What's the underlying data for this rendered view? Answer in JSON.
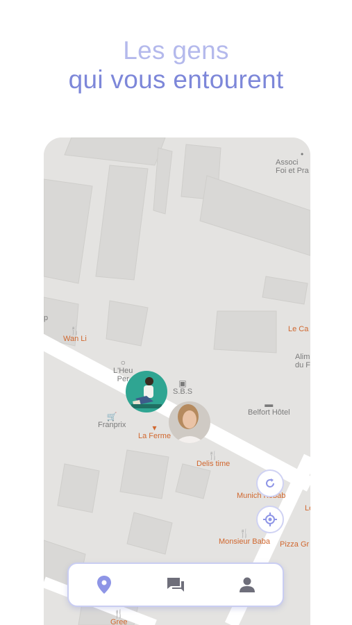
{
  "headline": {
    "line1": "Les gens",
    "line2": "qui vous entourent"
  },
  "map": {
    "pois": [
      {
        "id": "assoc",
        "label": "Associ",
        "label2": "Foi et Pra",
        "icon": "dot",
        "style": "gray"
      },
      {
        "id": "wanli",
        "label": "Wan Li",
        "icon": "restaurant-icon"
      },
      {
        "id": "lheu",
        "label": "L'Heu",
        "label2": "Per",
        "icon": "ring-icon",
        "style": "gray"
      },
      {
        "id": "sbs",
        "label": "S.B.S",
        "icon": "camera-icon",
        "style": "gray"
      },
      {
        "id": "lecaf",
        "label": "Le Ca",
        "icon": "none"
      },
      {
        "id": "alim",
        "label": "Alim",
        "label2": "du F",
        "icon": "none",
        "style": "gray"
      },
      {
        "id": "belfort",
        "label": "Belfort Hôtel",
        "icon": "bed-icon",
        "style": "gray"
      },
      {
        "id": "franprix",
        "label": "Franprix",
        "icon": "cart-icon",
        "style": "gray"
      },
      {
        "id": "laferme",
        "label": "La Ferme",
        "icon": "drink-icon"
      },
      {
        "id": "delis",
        "label": "Delis time",
        "icon": "restaurant-icon"
      },
      {
        "id": "munich",
        "label": "Munich Kebab",
        "icon": "none"
      },
      {
        "id": "baba",
        "label": "Monsieur Baba",
        "icon": "restaurant-icon"
      },
      {
        "id": "pizza",
        "label": "Pizza Gr",
        "icon": "none"
      },
      {
        "id": "le",
        "label": "Le",
        "icon": "none"
      },
      {
        "id": "gree",
        "label": "Gree",
        "icon": "restaurant-icon"
      },
      {
        "id": "p",
        "label": "p",
        "icon": "none",
        "style": "gray"
      }
    ],
    "users": [
      {
        "name": "avatar-man-teal"
      },
      {
        "name": "avatar-woman"
      }
    ]
  },
  "controls": {
    "refresh_icon": "refresh-icon",
    "locate_icon": "crosshair-icon"
  },
  "nav": {
    "items": [
      {
        "icon": "location-pin-icon",
        "active": true
      },
      {
        "icon": "chat-icon",
        "active": false
      },
      {
        "icon": "person-icon",
        "active": false
      }
    ]
  },
  "colors": {
    "accent": "#8e95e6",
    "nav_icon": "#6e6e7a",
    "poi_orange": "#d0672e"
  }
}
